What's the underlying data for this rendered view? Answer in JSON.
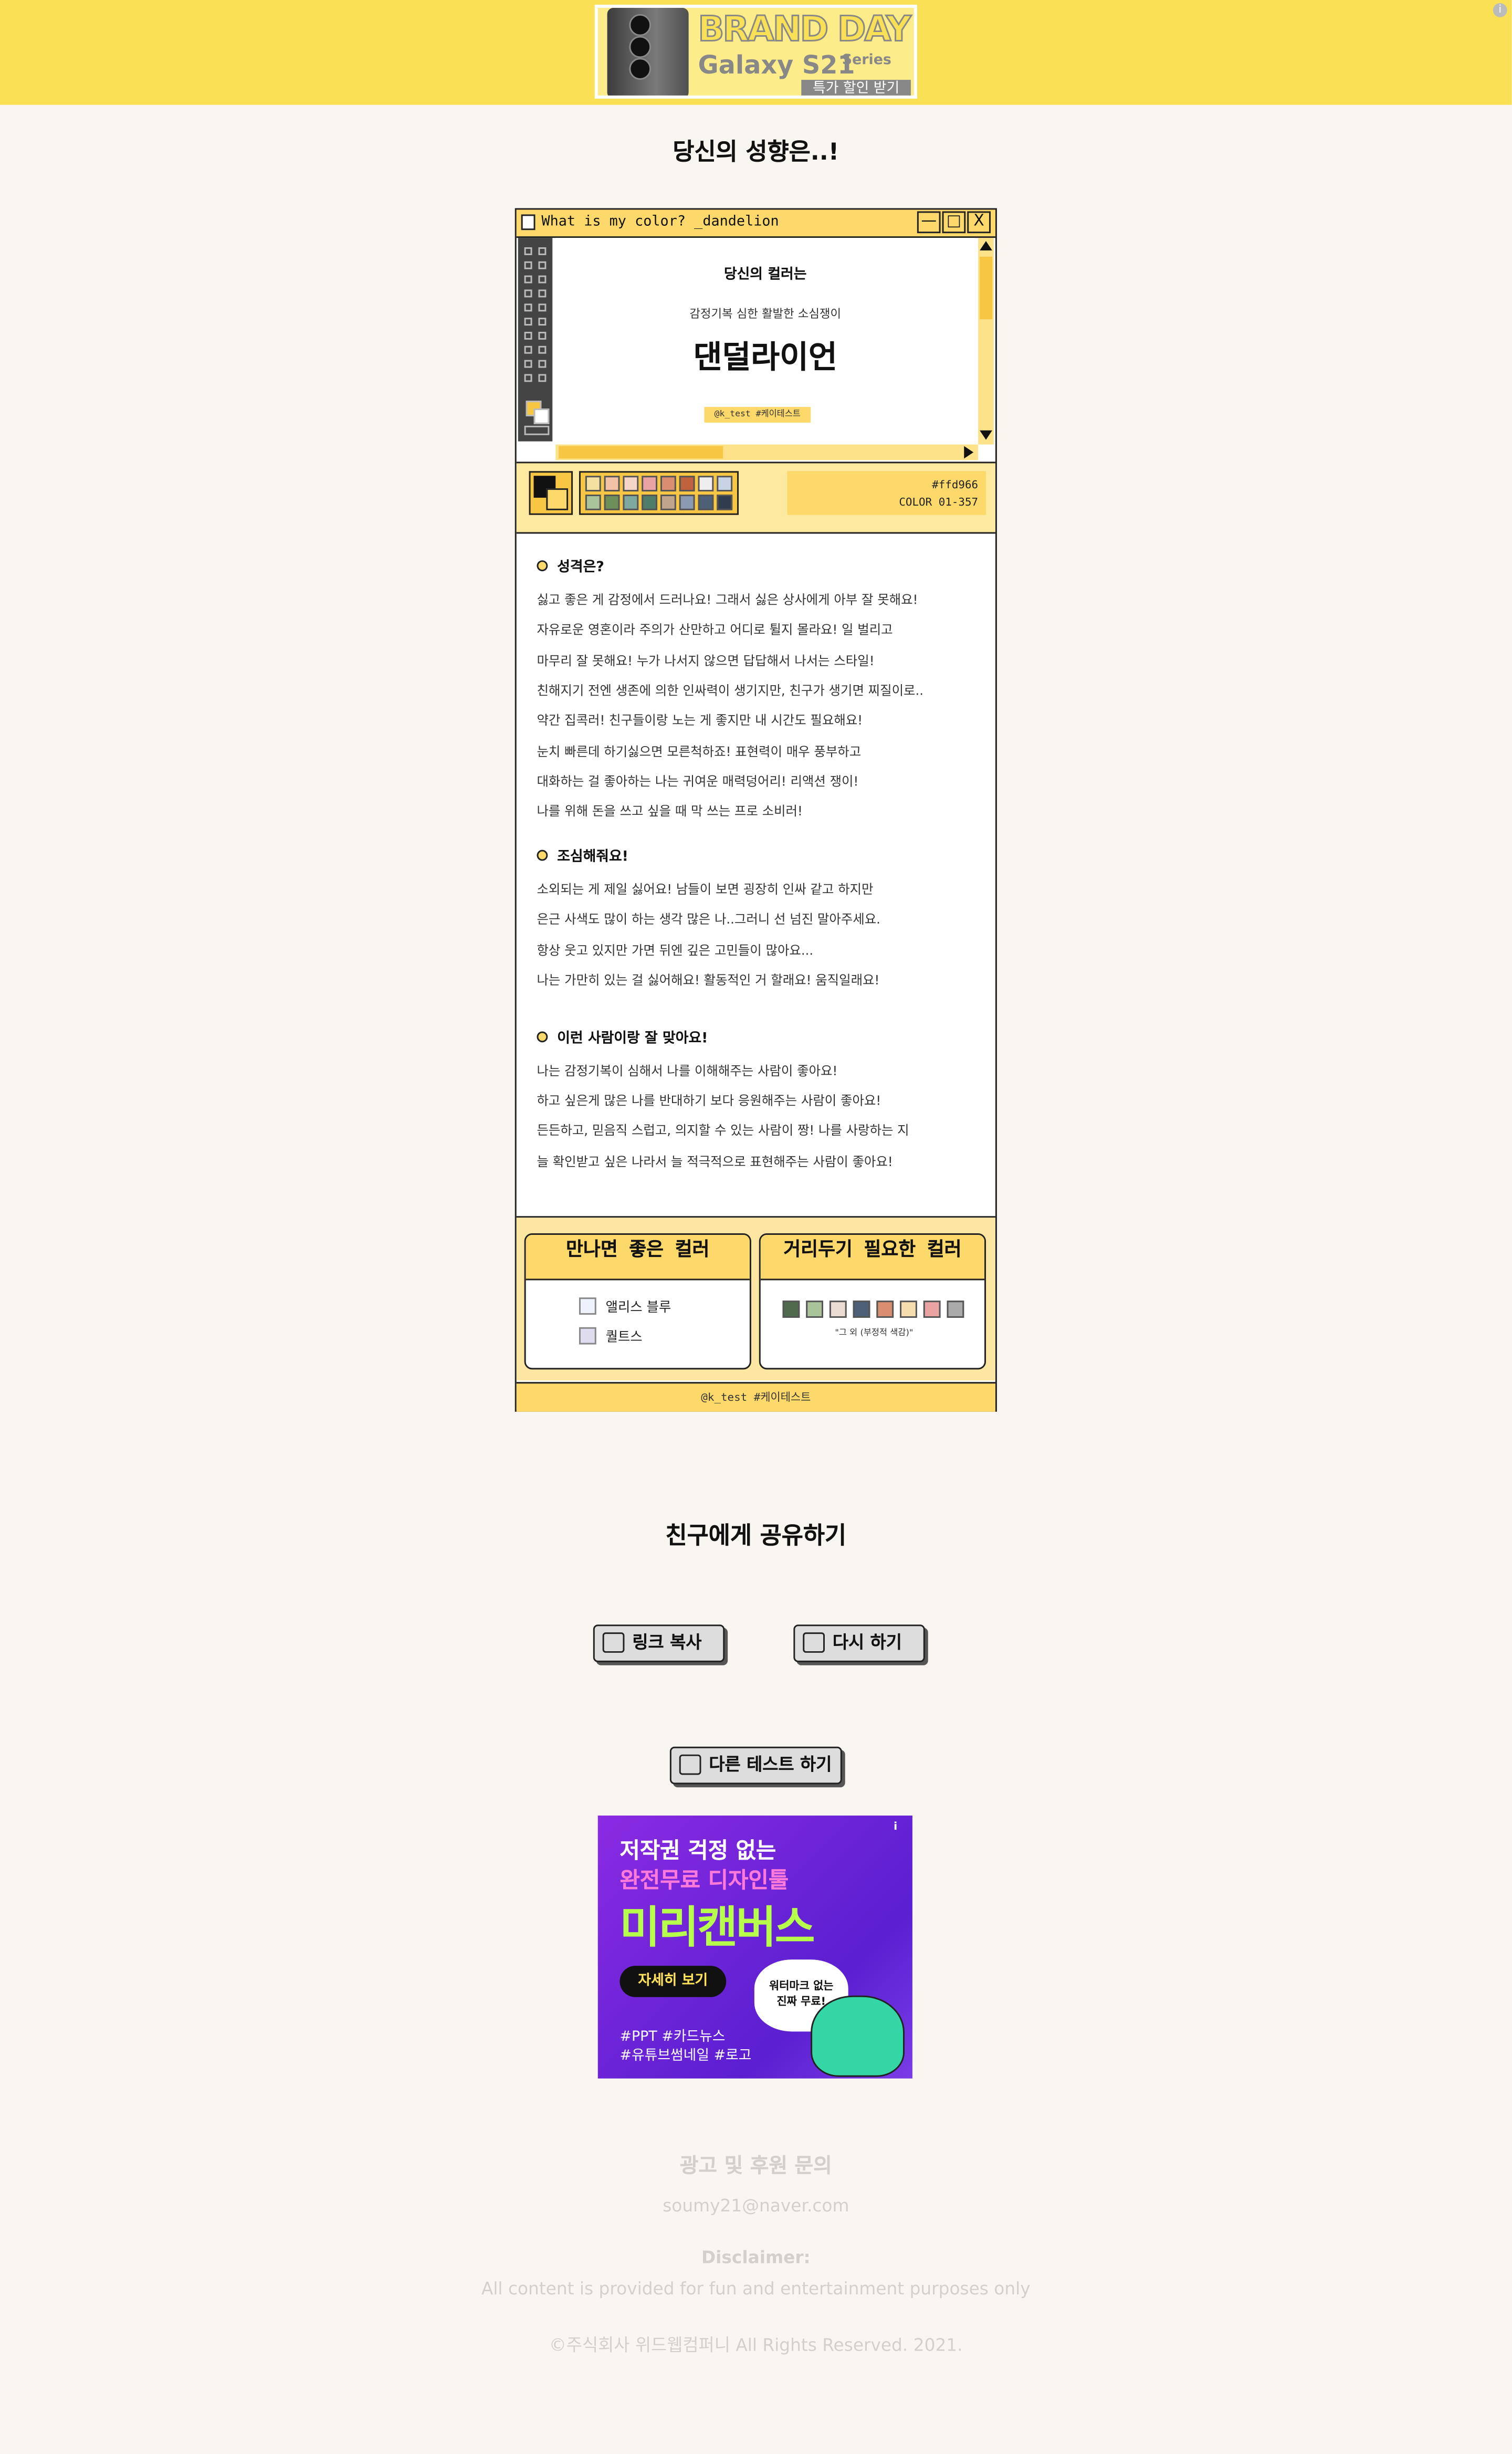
{
  "top_ad": {
    "brand_day": "BRAND DAY",
    "product": "Galaxy S21",
    "series": "Series",
    "cta": "특가 할인 받기"
  },
  "page_title": "당신의 성향은..!",
  "window": {
    "title": "What is my color? _dandelion",
    "controls": [
      "—",
      "□",
      "X"
    ],
    "canvas": {
      "heading": "당신의 컬러는",
      "subtitle": "감정기복 심한 활발한 소심쟁이",
      "color_name": "댄덜라이언",
      "tag": "@k_test #케이테스트"
    },
    "hex_code": "#ffd966",
    "color_code": "COLOR 01-357",
    "swatch_colors": [
      "#f4e0a0",
      "#f2c1a6",
      "#f5d5c8",
      "#e9a3a3",
      "#d98f6f",
      "#c0623e",
      "#eeeeee",
      "#c9d3e6",
      "#a9c39a",
      "#6f8f5a",
      "#7ea9a0",
      "#4e7d6a",
      "#c1a58b",
      "#8a9ab0",
      "#4d6078",
      "#2f3d4f"
    ]
  },
  "sections": [
    {
      "heading": "성격은?",
      "lines": [
        "싫고 좋은 게 감정에서 드러나요! 그래서 싫은 상사에게 아부 잘 못해요!",
        "자유로운 영혼이라 주의가 산만하고 어디로 튈지 몰라요! 일 벌리고",
        "마무리 잘 못해요! 누가 나서지 않으면 답답해서 나서는 스타일!",
        "친해지기 전엔 생존에 의한 인싸력이 생기지만, 친구가 생기면 찌질이로..",
        "약간 집콕러! 친구들이랑 노는 게 좋지만 내 시간도 필요해요!",
        "눈치 빠른데 하기싫으면 모른척하죠! 표현력이 매우 풍부하고",
        "대화하는 걸 좋아하는 나는 귀여운 매력덩어리! 리액션 쟁이!",
        "나를 위해 돈을 쓰고 싶을 때 막 쓰는 프로 소비러!"
      ]
    },
    {
      "heading": "조심해줘요!",
      "lines": [
        "소외되는 게 제일 싫어요!  남들이 보면 굉장히 인싸 같고 하지만",
        "은근 사색도 많이 하는 생각 많은 나..그러니 선 넘진 말아주세요.",
        "항상 웃고 있지만 가면 뒤엔 깊은 고민들이 많아요...",
        "나는 가만히 있는 걸 싫어해요!  활동적인 거 할래요! 움직일래요!"
      ]
    },
    {
      "heading": "이런 사람이랑 잘 맞아요!",
      "lines": [
        "나는 감정기복이 심해서 나를 이해해주는 사람이 좋아요!",
        "하고 싶은게 많은 나를 반대하기 보다 응원해주는 사람이 좋아요!",
        "든든하고, 믿음직 스럽고, 의지할 수 있는 사람이 짱! 나를 사랑하는 지",
        "늘 확인받고 싶은 나라서 늘 적극적으로 표현해주는 사람이 좋아요!"
      ]
    }
  ],
  "good_colors": {
    "title": "만나면 좋은 컬러",
    "items": [
      {
        "name": "앨리스 블루",
        "color": "#eef2fb"
      },
      {
        "name": "퀄트스",
        "color": "#e0dcef"
      }
    ]
  },
  "bad_colors": {
    "title": "거리두기 필요한 컬러",
    "colors": [
      "#4e6b4e",
      "#a9c39a",
      "#eadbd3",
      "#4d6078",
      "#d98f6f",
      "#f7dcae",
      "#e9a3a3",
      "#aaaaaa"
    ],
    "caption": "\"그 외 (부정적 색감)\""
  },
  "window_footer": "@k_test #케이테스트",
  "share": {
    "title": "친구에게 공유하기",
    "copy_link": "링크 복사",
    "retry": "다시 하기",
    "other_test": "다른 테스트 하기"
  },
  "bottom_ad": {
    "line1": "저작권 걱정 없는",
    "line2": "완전무료 디자인툴",
    "brand": "미리캔버스",
    "cta": "자세히 보기",
    "burst": "워터마크 없는 진짜 무료!",
    "tags1": "#PPT #카드뉴스",
    "tags2": "#유튜브썸네일 #로고"
  },
  "footer": {
    "contact_title": "광고 및 후원 문의",
    "email": "soumy21@naver.com",
    "disclaimer_title": "Disclaimer:",
    "disclaimer_text": "All content is provided for fun and entertainment purposes only",
    "copyright": "©주식회사 위드웹컴퍼니 All Rights Reserved. 2021."
  }
}
